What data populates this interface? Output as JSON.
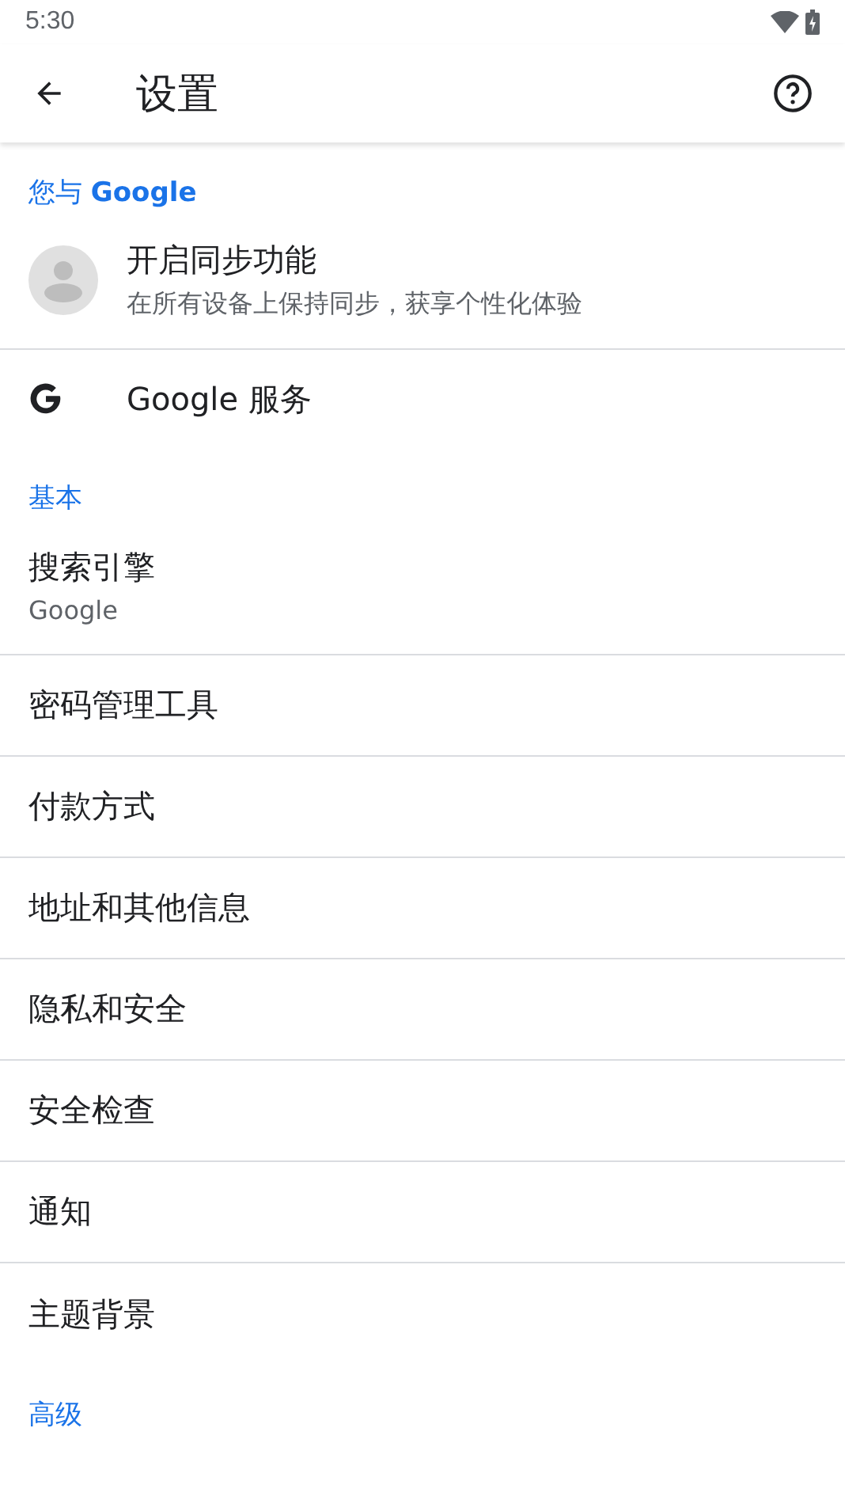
{
  "status_bar": {
    "time": "5:30"
  },
  "toolbar": {
    "title": "设置"
  },
  "sections": [
    {
      "header": "您与 **Google**",
      "items": [
        {
          "kind": "account",
          "title": "开启同步功能",
          "subtitle": "在所有设备上保持同步，获享个性化体验"
        },
        {
          "kind": "service",
          "title": "Google 服务"
        }
      ]
    },
    {
      "header": "基本",
      "items": [
        {
          "kind": "setting",
          "title": "搜索引擎",
          "subtitle": "Google"
        },
        {
          "kind": "setting",
          "title": "密码管理工具"
        },
        {
          "kind": "setting",
          "title": "付款方式"
        },
        {
          "kind": "setting",
          "title": "地址和其他信息"
        },
        {
          "kind": "setting",
          "title": "隐私和安全"
        },
        {
          "kind": "setting",
          "title": "安全检查"
        },
        {
          "kind": "setting",
          "title": "通知"
        },
        {
          "kind": "setting",
          "title": "主题背景"
        }
      ]
    },
    {
      "header": "高级"
    }
  ]
}
